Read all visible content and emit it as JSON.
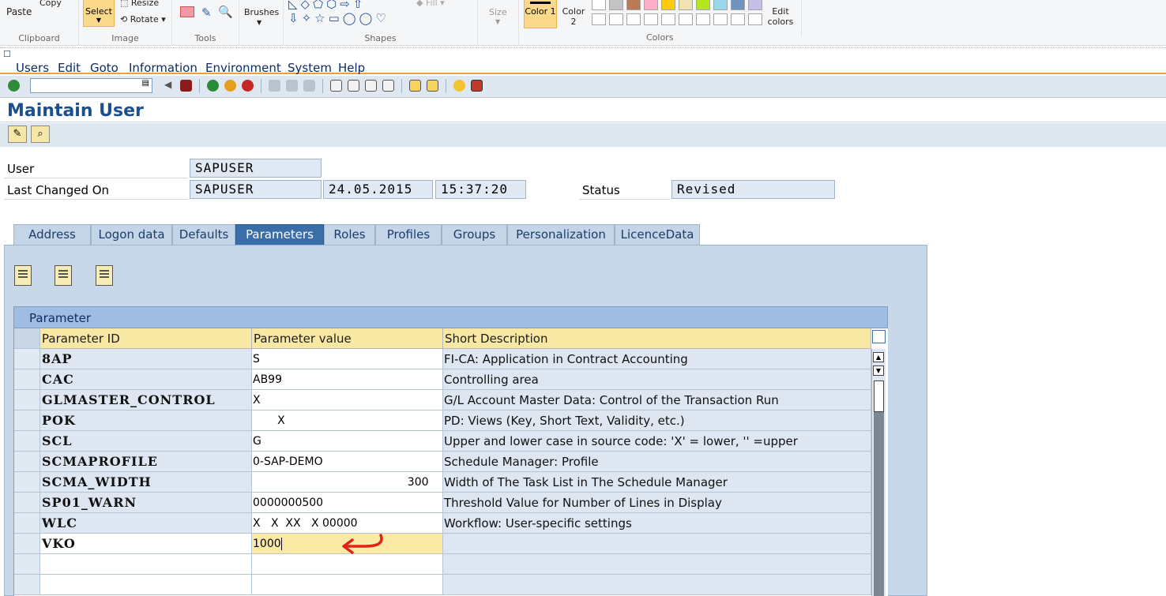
{
  "ribbon": {
    "clipboard": {
      "paste": "Paste",
      "copy": "Copy",
      "label": "Clipboard"
    },
    "image": {
      "select": "Select",
      "resize": "Resize",
      "rotate": "Rotate",
      "label": "Image"
    },
    "tools": {
      "label": "Tools"
    },
    "brushes": {
      "label": "Brushes"
    },
    "shapes": {
      "label": "Shapes",
      "fill": "Fill"
    },
    "size": {
      "label": "Size"
    },
    "colors": {
      "color1": "Color 1",
      "color2": "Color 2",
      "edit": "Edit colors",
      "label": "Colors",
      "palette_top": [
        "#ffffff",
        "#c3c3c3",
        "#b97a57",
        "#ffaec9",
        "#ffc90e",
        "#efe4b0",
        "#b5e61d",
        "#99d9ea",
        "#7092be",
        "#c8bfe7"
      ]
    }
  },
  "menu": [
    "Users",
    "Edit",
    "Goto",
    "Information",
    "Environment",
    "System",
    "Help"
  ],
  "page": {
    "title": "Maintain User"
  },
  "header": {
    "user_label": "User",
    "user_value": "SAPUSER",
    "changed_label": "Last Changed On",
    "changed_by": "SAPUSER",
    "changed_date": "24.05.2015",
    "changed_time": "15:37:20",
    "status_label": "Status",
    "status_value": "Revised"
  },
  "tabs": [
    {
      "label": "Address",
      "active": false
    },
    {
      "label": "Logon data",
      "active": false
    },
    {
      "label": "Defaults",
      "active": false
    },
    {
      "label": "Parameters",
      "active": true
    },
    {
      "label": "Roles",
      "active": false
    },
    {
      "label": "Profiles",
      "active": false
    },
    {
      "label": "Groups",
      "active": false
    },
    {
      "label": "Personalization",
      "active": false
    },
    {
      "label": "LicenceData",
      "active": false
    }
  ],
  "table": {
    "title": "Parameter",
    "columns": [
      "Parameter ID",
      "Parameter value",
      "Short Description"
    ],
    "rows": [
      {
        "id": "8AP",
        "value": "S",
        "desc": "FI-CA: Application in Contract Accounting"
      },
      {
        "id": "CAC",
        "value": "AB99",
        "desc": "Controlling area"
      },
      {
        "id": "GLMASTER_CONTROL",
        "value": "X",
        "desc": "G/L Account Master Data: Control of the Transaction Run"
      },
      {
        "id": "POK",
        "value": "       X",
        "desc": "PD: Views (Key, Short Text, Validity, etc.)"
      },
      {
        "id": "SCL",
        "value": "G",
        "desc": "Upper and lower case in source code: 'X' = lower, '' =upper"
      },
      {
        "id": "SCMAPROFILE",
        "value": "0-SAP-DEMO",
        "desc": "Schedule Manager: Profile"
      },
      {
        "id": "SCMA_WIDTH",
        "value": "                                            300",
        "desc": "Width of The Task List in The Schedule Manager"
      },
      {
        "id": "SP01_WARN",
        "value": "0000000500",
        "desc": "Threshold Value for Number of Lines in Display"
      },
      {
        "id": "WLC",
        "value": "X   X  XX   X 00000",
        "desc": "Workflow: User-specific settings"
      },
      {
        "id": "VKO",
        "value": "1000",
        "desc": ""
      }
    ]
  }
}
